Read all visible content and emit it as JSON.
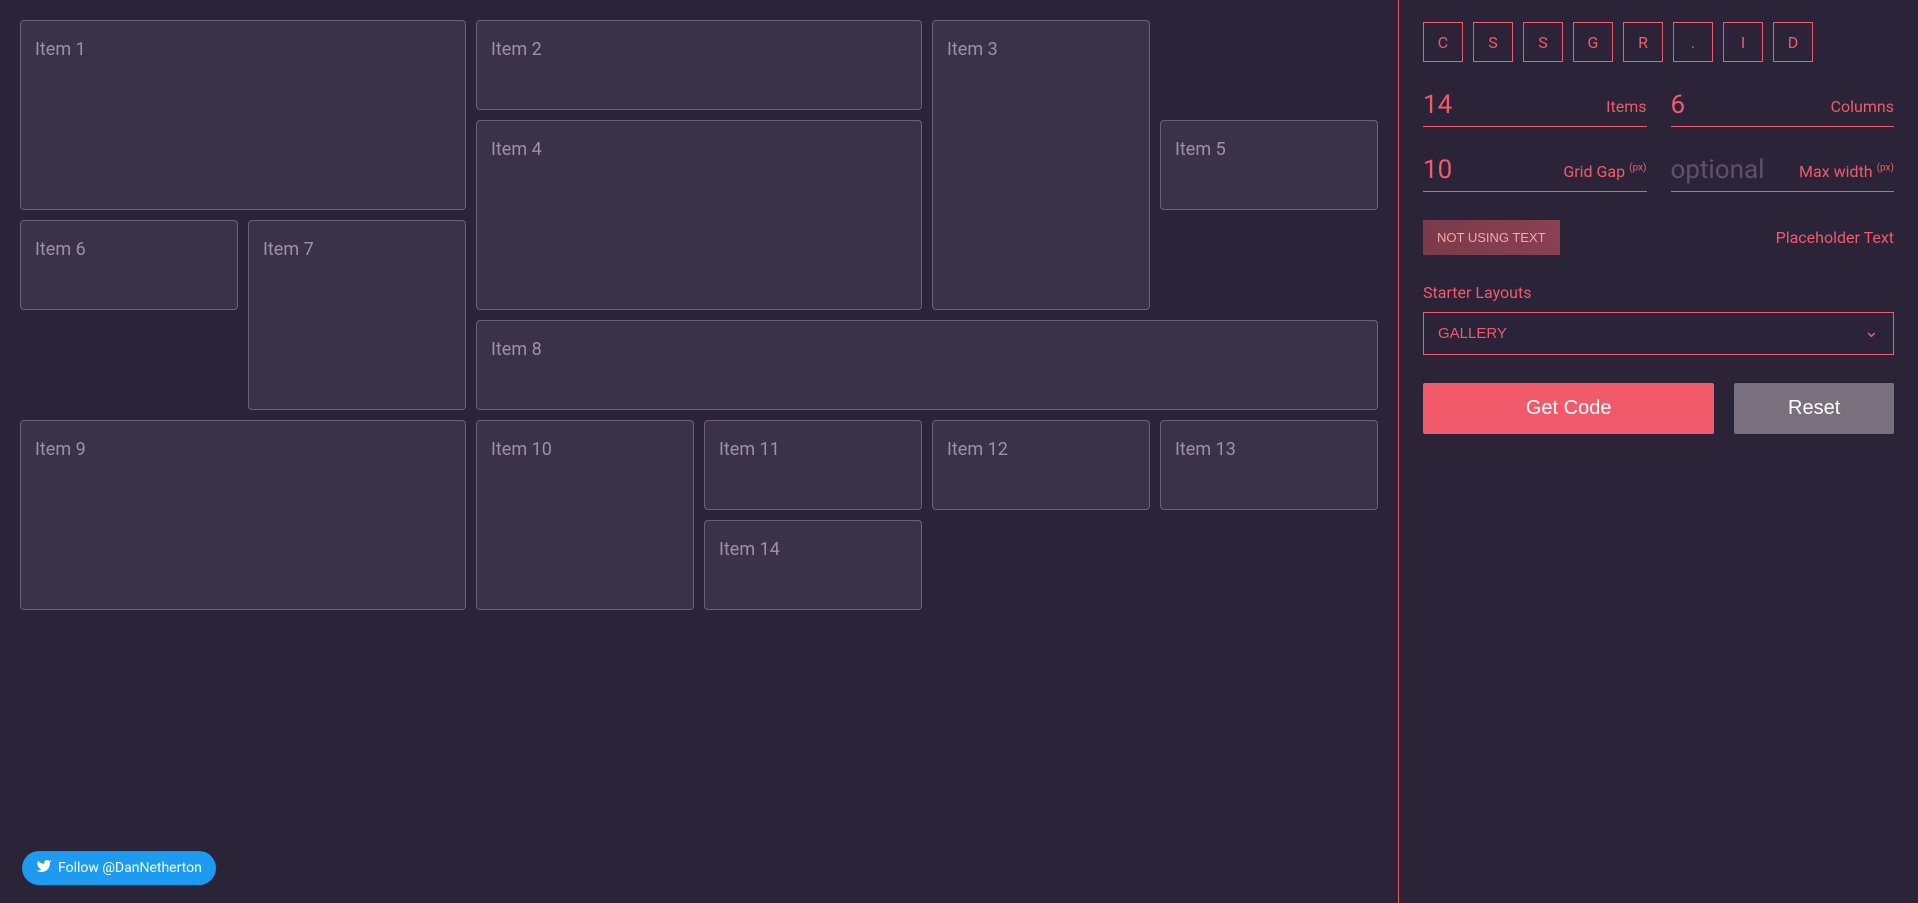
{
  "logo": [
    "C",
    "S",
    "S",
    "G",
    "R",
    ".",
    "I",
    "D"
  ],
  "controls": {
    "items": {
      "value": "14",
      "label": "Items"
    },
    "columns": {
      "value": "6",
      "label": "Columns"
    },
    "grid_gap": {
      "value": "10",
      "label": "Grid Gap",
      "unit": "(px)"
    },
    "max_width": {
      "value": "",
      "placeholder": "optional",
      "label": "Max width",
      "unit": "(px)"
    }
  },
  "placeholder_toggle": {
    "button": "NOT USING TEXT",
    "label": "Placeholder Text"
  },
  "starter": {
    "label": "Starter Layouts",
    "selected": "GALLERY"
  },
  "buttons": {
    "get_code": "Get Code",
    "reset": "Reset"
  },
  "grid_items": [
    "Item 1",
    "Item 2",
    "Item 3",
    "Item 4",
    "Item 5",
    "Item 6",
    "Item 7",
    "Item 8",
    "Item 9",
    "Item 10",
    "Item 11",
    "Item 12",
    "Item 13",
    "Item 14"
  ],
  "twitter": "Follow @DanNetherton"
}
